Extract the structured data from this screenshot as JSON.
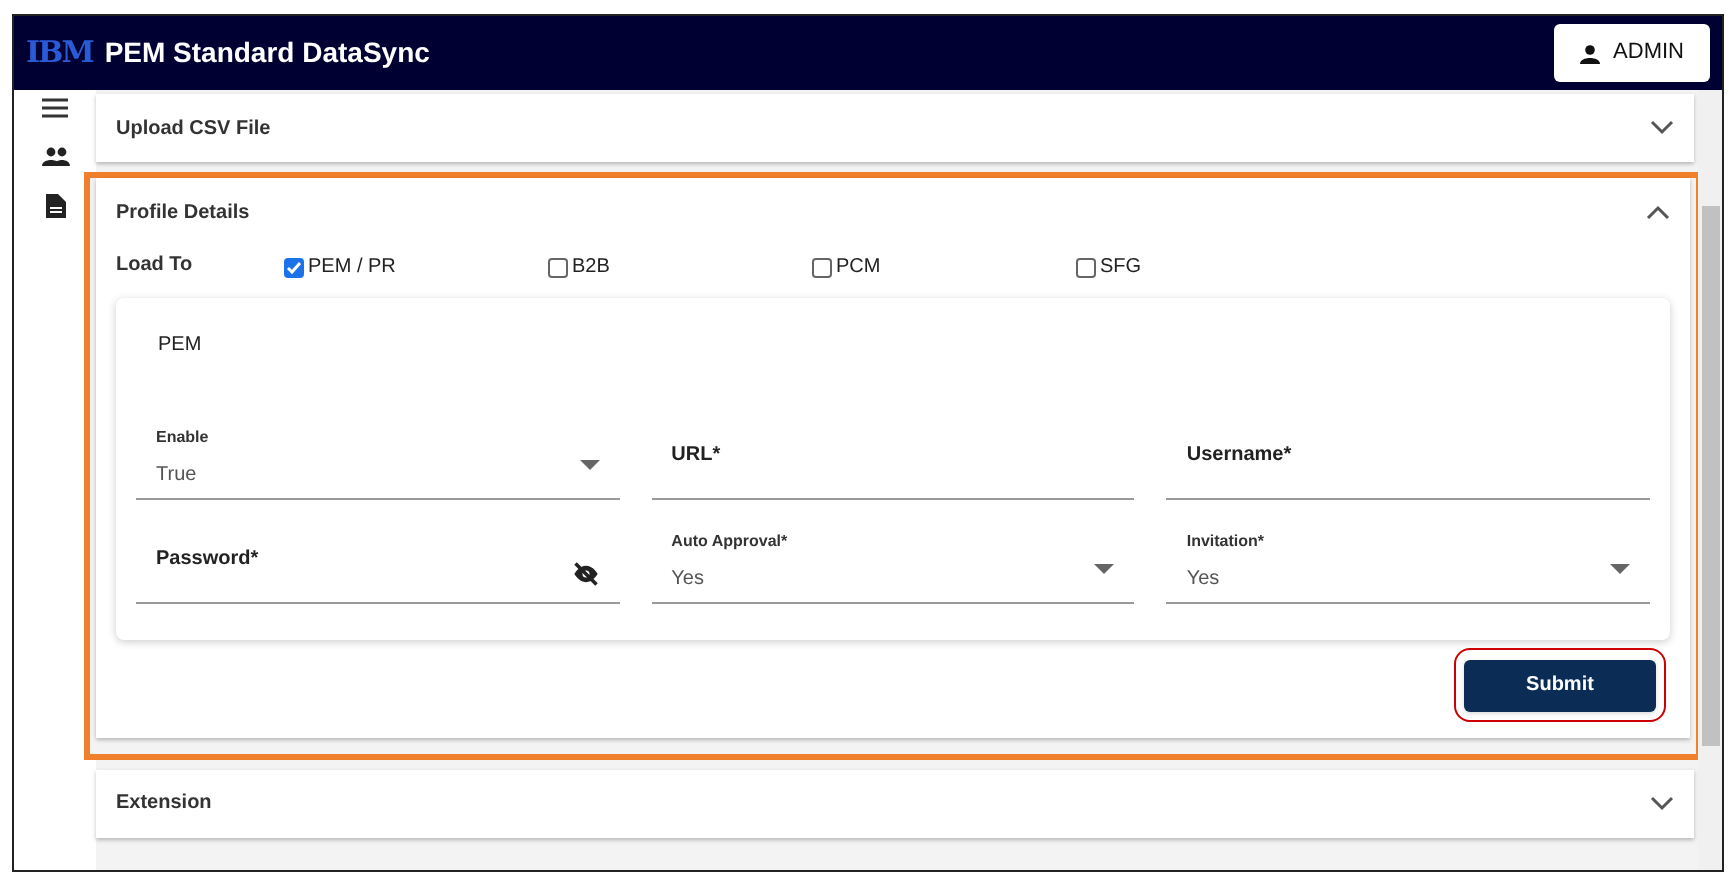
{
  "header": {
    "logo": "IBM",
    "title": "PEM Standard DataSync",
    "user_button": "ADMIN"
  },
  "sections": [
    {
      "title": "Upload CSV File",
      "expanded": false
    },
    {
      "title": "Profile Details",
      "expanded": true,
      "highlighted": true
    },
    {
      "title": "Extension",
      "expanded": false
    }
  ],
  "profile": {
    "load_to_label": "Load To",
    "options": [
      {
        "label": "PEM / PR",
        "checked": true
      },
      {
        "label": "B2B",
        "checked": false
      },
      {
        "label": "PCM",
        "checked": false
      },
      {
        "label": "SFG",
        "checked": false
      }
    ],
    "card_title": "PEM",
    "fields": [
      {
        "kind": "select",
        "label": "Enable",
        "value": "True"
      },
      {
        "kind": "text",
        "label": "URL*"
      },
      {
        "kind": "text",
        "label": "Username*"
      },
      {
        "kind": "password",
        "label": "Password*"
      },
      {
        "kind": "select",
        "label": "Auto Approval*",
        "value": "Yes"
      },
      {
        "kind": "select",
        "label": "Invitation*",
        "value": "Yes"
      }
    ],
    "submit": {
      "label": "Submit",
      "highlighted": true
    }
  }
}
